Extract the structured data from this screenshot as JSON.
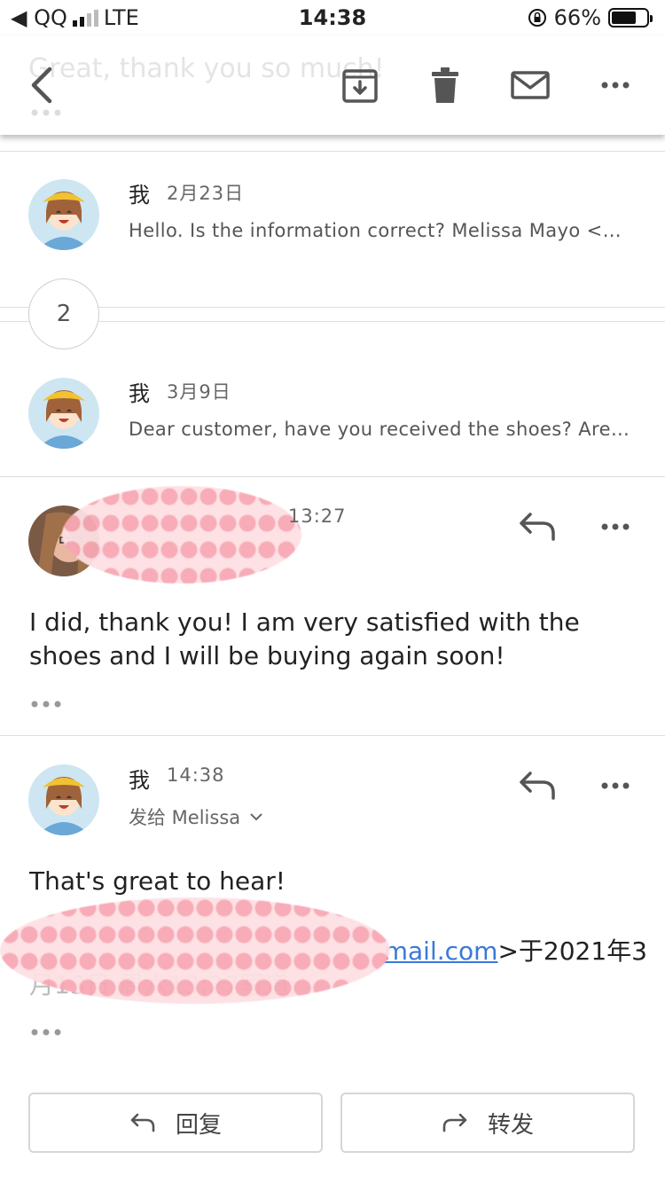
{
  "status_bar": {
    "carrier": "◀ QQ",
    "network": "LTE",
    "time": "14:38",
    "battery": "66%"
  },
  "toolbar": {
    "ghost_subject": "Great, thank you so much!"
  },
  "thread": {
    "messages": [
      {
        "sender": "我",
        "date": "2月23日",
        "snippet": "Hello. Is the information correct?   Melissa Mayo <m..."
      },
      {
        "collapsed_count": "2"
      },
      {
        "sender": "我",
        "date": "3月9日",
        "snippet": "Dear customer, have you received the shoes? Are y..."
      },
      {
        "time": "13:27",
        "body": "I did, thank you! I am very satisfied with the shoes and I will be buying again soon!"
      },
      {
        "sender": "我",
        "time": "14:38",
        "recipient": "发给 Melissa",
        "body": "That's great to hear!",
        "quote_link": "mail.com",
        "quote_rest": ">于2021年3",
        "quote_line2": "月13日 周六13:27写道:"
      }
    ]
  },
  "actions": {
    "reply_label": "回复",
    "forward_label": "转发"
  },
  "colors": {
    "link": "#3a78d8",
    "icon_gray": "#555555"
  }
}
